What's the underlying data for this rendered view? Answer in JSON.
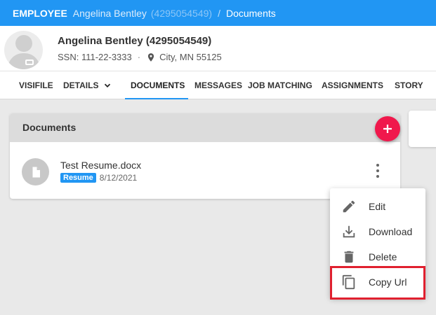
{
  "breadcrumb": {
    "role": "EMPLOYEE",
    "name": "Angelina Bentley",
    "id": "(4295054549)",
    "separator": "/",
    "page": "Documents"
  },
  "profile": {
    "name": "Angelina Bentley (4295054549)",
    "ssn": "SSN: 111-22-3333",
    "dot": "·",
    "location": "City, MN 55125"
  },
  "tabs": [
    {
      "label": "VISIFILE"
    },
    {
      "label": "DETAILS"
    },
    {
      "label": "DOCUMENTS"
    },
    {
      "label": "MESSAGES"
    },
    {
      "label": "JOB MATCHING"
    },
    {
      "label": "ASSIGNMENTS"
    },
    {
      "label": "STORY"
    }
  ],
  "active_tab": "DOCUMENTS",
  "documents": {
    "header": "Documents",
    "items": [
      {
        "title": "Test Resume.docx",
        "tag": "Resume",
        "date": "8/12/2021"
      }
    ]
  },
  "context_menu": {
    "items": [
      {
        "label": "Edit",
        "icon": "pencil-icon"
      },
      {
        "label": "Download",
        "icon": "download-icon"
      },
      {
        "label": "Delete",
        "icon": "trash-icon"
      },
      {
        "label": "Copy Url",
        "icon": "copy-icon"
      }
    ],
    "highlighted": "Copy Url"
  },
  "colors": {
    "topbar": "#2196f3",
    "fab": "#f0184c",
    "tag": "#2196f3",
    "highlight_border": "#e0202f"
  }
}
